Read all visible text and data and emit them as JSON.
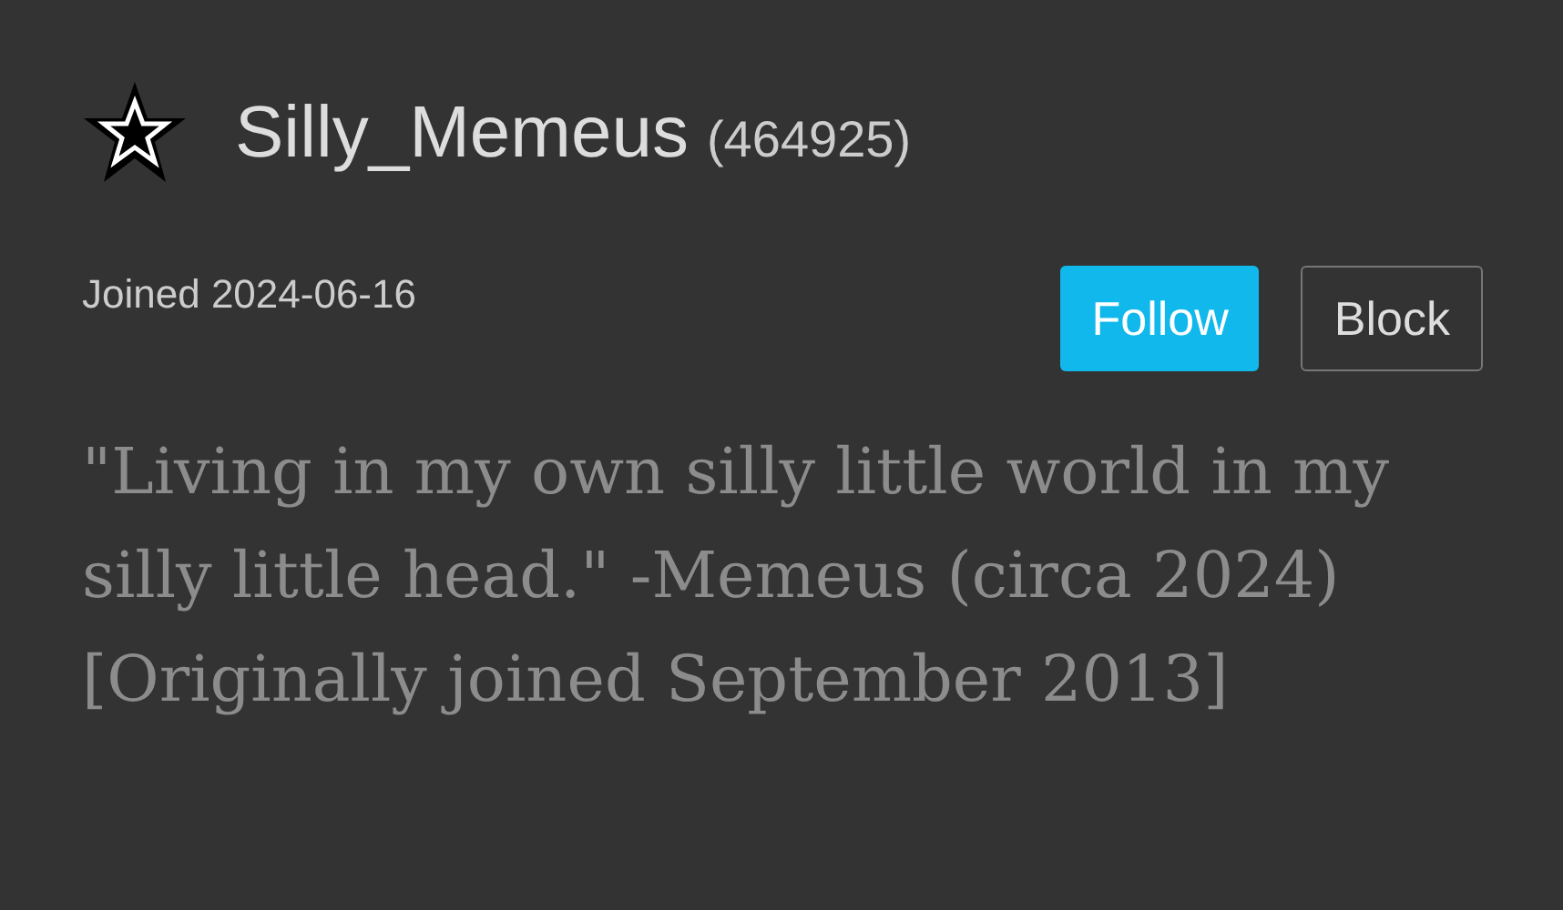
{
  "profile": {
    "username": "Silly_Memeus",
    "user_id": "(464925)",
    "joined": "Joined 2024-06-16"
  },
  "buttons": [
    {
      "label": "Follow",
      "kind": "primary"
    },
    {
      "label": "Block",
      "kind": "outline"
    }
  ],
  "bio": "\"Living in my own silly little world in my silly little head.\" -Memeus (circa 2024) [Originally joined September 2013]"
}
